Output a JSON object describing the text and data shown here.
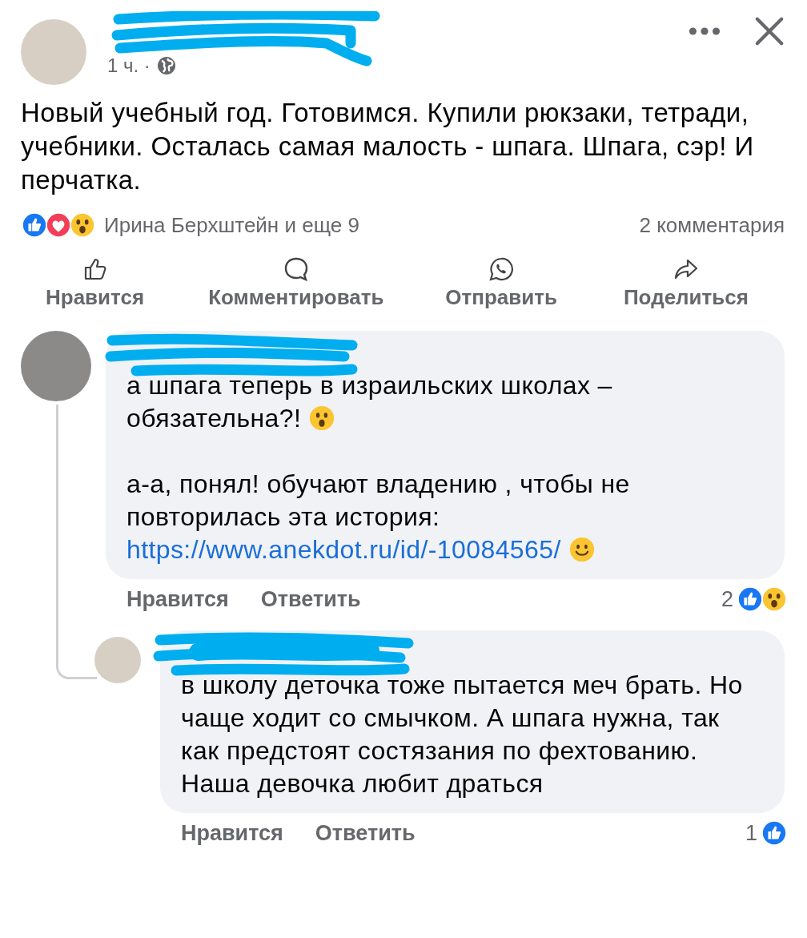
{
  "post": {
    "time": "1 ч. ·",
    "text": "Новый учебный год. Готовимся. Купили рюкзаки, тетради, учебники. Осталась самая малость - шпага. Шпага, сэр! И перчатка.",
    "reactions": [
      {
        "kind": "like"
      },
      {
        "kind": "love"
      },
      {
        "kind": "wow"
      }
    ],
    "reactions_summary": "Ирина Берхштейн и еще 9",
    "comments_count": "2 комментария",
    "actions": [
      {
        "kind": "like",
        "label": "Нравится"
      },
      {
        "kind": "comment",
        "label": "Комментировать"
      },
      {
        "kind": "whatsapp",
        "label": "Отправить"
      },
      {
        "kind": "share",
        "label": "Поделиться"
      }
    ]
  },
  "comments": [
    {
      "paragraphs": [
        {
          "kind": "text",
          "text": "а шпага теперь в израильских школах – обязательна?!",
          "emoji": {
            "kind": "wow"
          }
        },
        {
          "kind": "text",
          "text": "а-а, понял! обучают владению , чтобы не повторилась эта история:"
        },
        {
          "kind": "link",
          "text": "https://www.anekdot.ru/id/-10084565/",
          "emoji": {
            "kind": "smile"
          }
        }
      ],
      "like_label": "Нравится",
      "reply_label": "Ответить",
      "reaction_count": "2",
      "reactions": [
        {
          "kind": "like"
        },
        {
          "kind": "wow"
        }
      ],
      "replies": [
        {
          "paragraphs": [
            {
              "kind": "text",
              "text": "в школу деточка тоже пытается меч брать. Но чаще ходит со смычком. А шпага нужна, так как предстоят состязания по фехтованию. Наша девочка любит драться"
            }
          ],
          "like_label": "Нравится",
          "reply_label": "Ответить",
          "reaction_count": "1",
          "reactions": [
            {
              "kind": "like"
            }
          ]
        }
      ]
    }
  ]
}
